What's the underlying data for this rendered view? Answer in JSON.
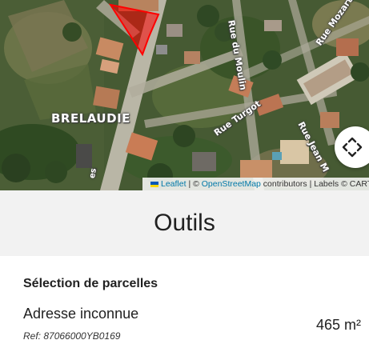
{
  "map": {
    "place_label": "BRELAUDIE",
    "streets": {
      "moulin": "Rue du Moulin",
      "mozart": "Rue Mozart",
      "turgot": "Rue Turgot",
      "jean": "Rue Jean M",
      "partial": "es"
    },
    "locate_icon": "move-arrows-icon",
    "selected_parcel_color": "#ff0000"
  },
  "attribution": {
    "leaflet": "Leaflet",
    "sep1": " | © ",
    "osm": "OpenStreetMap",
    "rest": " contributors | Labels © CART"
  },
  "tools": {
    "title": "Outils"
  },
  "parcel": {
    "heading": "Sélection de parcelles",
    "address": "Adresse inconnue",
    "ref": "Ref: 87066000YB0169",
    "area": "465 m²"
  }
}
